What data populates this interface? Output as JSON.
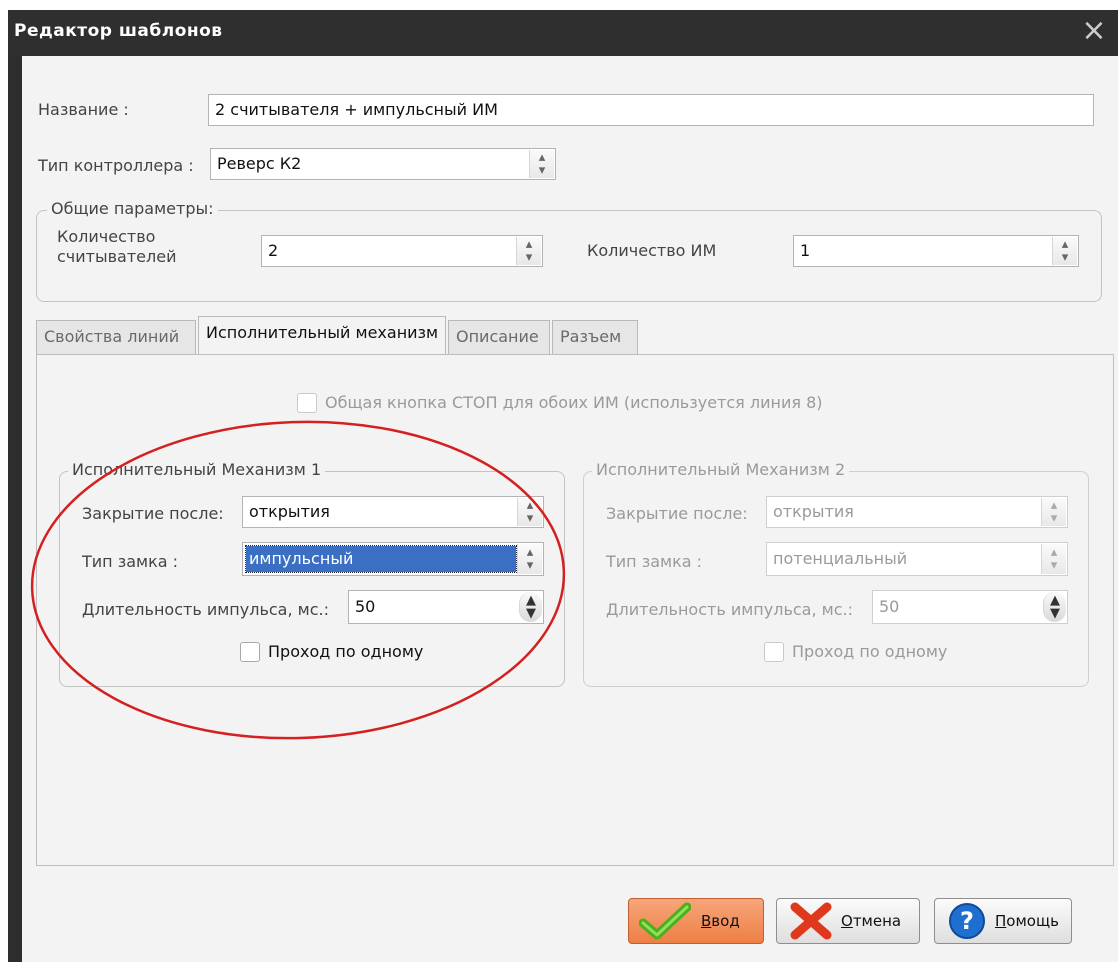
{
  "window": {
    "title": "Редактор шаблонов",
    "close_glyph": "×"
  },
  "form": {
    "name_label": "Название :",
    "name_value": "2 считывателя + импульсный ИМ",
    "controller_label": "Тип контроллера :",
    "controller_value": "Реверс К2"
  },
  "general": {
    "legend": "Общие параметры:",
    "readers_label_line1": "Количество",
    "readers_label_line2": "считывателей",
    "readers_value": "2",
    "im_count_label": "Количество  ИМ",
    "im_count_value": "1"
  },
  "tabs": [
    {
      "label": "Свойства линий",
      "active": false
    },
    {
      "label": "Исполнительный механизм",
      "active": true
    },
    {
      "label": "Описание",
      "active": false
    },
    {
      "label": "Разъем",
      "active": false
    }
  ],
  "tab_content": {
    "common_stop_label": "Общая кнопка СТОП для обоих ИМ (используется линия 8)",
    "im1": {
      "legend": "Исполнительный Механизм 1",
      "close_after_label": "Закрытие после:",
      "close_after_value": "открытия",
      "lock_type_label": "Тип замка :",
      "lock_type_value": "импульсный",
      "pulse_label": "Длительность импульса, мс.:",
      "pulse_value": "50",
      "single_pass_label": "Проход по одному"
    },
    "im2": {
      "legend": "Исполнительный Механизм 2",
      "close_after_label": "Закрытие после:",
      "close_after_value": "открытия",
      "lock_type_label": "Тип замка :",
      "lock_type_value": "потенциальный",
      "pulse_label": "Длительность импульса, мс.:",
      "pulse_value": "50",
      "single_pass_label": "Проход по одному"
    }
  },
  "buttons": {
    "ok_first": "В",
    "ok_rest": "вод",
    "cancel_first": "О",
    "cancel_rest": "тмена",
    "help_first": "П",
    "help_rest": "омощь"
  },
  "colors": {
    "annotation": "#d42020",
    "selection": "#3a6fc4",
    "ok_button": "#f08a52",
    "check_green": "#4caf1e",
    "cancel_red": "#e0381c",
    "help_blue": "#1e6fcf"
  },
  "icons": {
    "ok": "check-icon",
    "cancel": "x-icon",
    "help": "question-icon"
  }
}
